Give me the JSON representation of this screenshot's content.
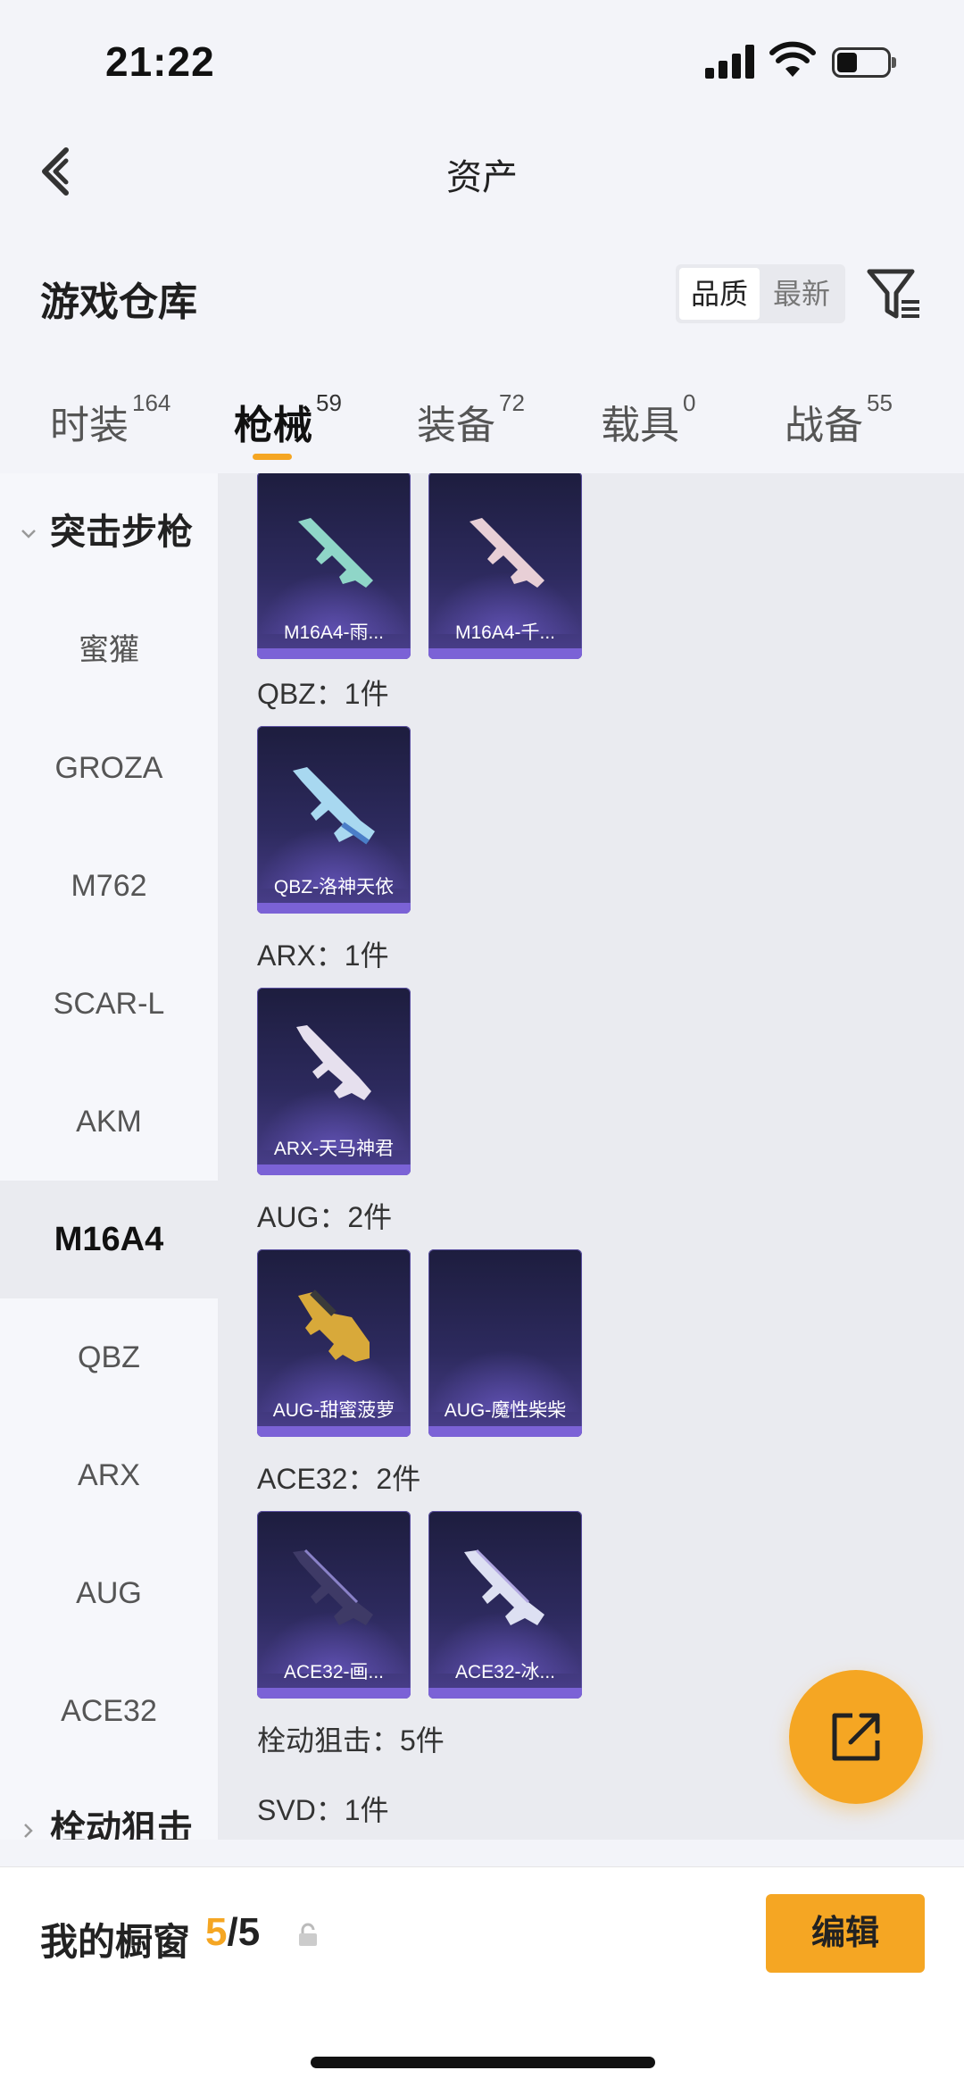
{
  "status_bar": {
    "time": "21:22"
  },
  "nav": {
    "title": "资产"
  },
  "warehouse": {
    "title": "游戏仓库",
    "sort_options": [
      "品质",
      "最新"
    ],
    "active_sort": "品质"
  },
  "tabs": [
    {
      "label": "时装",
      "count": "164"
    },
    {
      "label": "枪械",
      "count": "59",
      "active": true
    },
    {
      "label": "装备",
      "count": "72"
    },
    {
      "label": "载具",
      "count": "0"
    },
    {
      "label": "战备",
      "count": "55"
    }
  ],
  "sidebar": {
    "group": "突击步枪",
    "items": [
      "蜜獾",
      "GROZA",
      "M762",
      "SCAR-L",
      "AKM",
      "M16A4",
      "QBZ",
      "ARX",
      "AUG",
      "ACE32"
    ],
    "active_item": "M16A4",
    "next_group": "栓动狙击"
  },
  "content": {
    "sections": [
      {
        "label": "",
        "items": [
          "M16A4-雨...",
          "M16A4-千..."
        ]
      },
      {
        "label": "QBZ：1件",
        "items": [
          "QBZ-洛神天依"
        ]
      },
      {
        "label": "ARX：1件",
        "items": [
          "ARX-天马神君"
        ]
      },
      {
        "label": "AUG：2件",
        "items": [
          "AUG-甜蜜菠萝",
          "AUG-魔性柴柴"
        ]
      },
      {
        "label": "ACE32：2件",
        "items": [
          "ACE32-画...",
          "ACE32-冰..."
        ]
      }
    ],
    "trailing_labels": [
      "栓动狙击：5件",
      "SVD：1件"
    ]
  },
  "showcase": {
    "label": "我的橱窗",
    "current": "5",
    "total": "/5",
    "edit_label": "编辑"
  },
  "colors": {
    "accent": "#f5a623",
    "card_bg": "#2d2a5e",
    "card_stripe": "#7b62d6"
  }
}
